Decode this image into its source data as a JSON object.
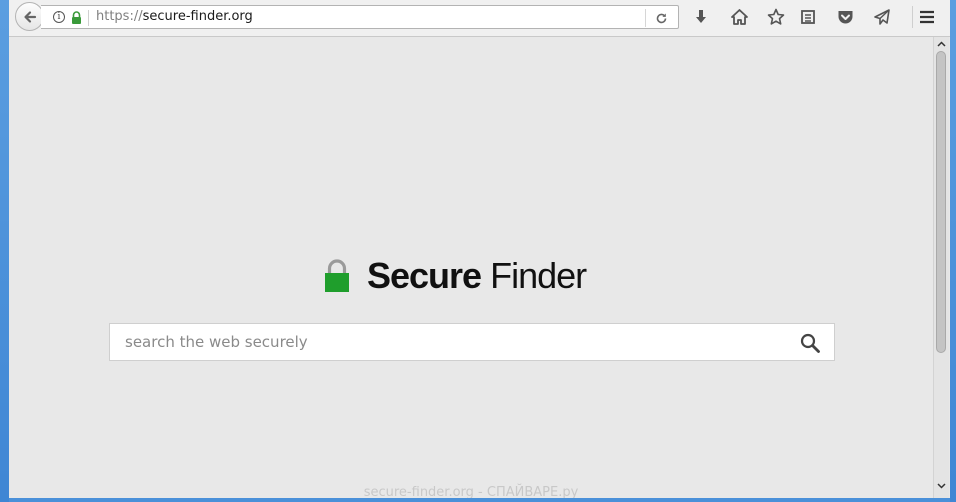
{
  "browser": {
    "url_protocol": "https://",
    "url_host": "secure-finder.org",
    "icons": [
      "back-icon",
      "info-icon",
      "lock-icon",
      "reload-icon",
      "download-icon",
      "home-icon",
      "bookmark-star-icon",
      "reading-list-icon",
      "pocket-icon",
      "send-icon",
      "menu-icon"
    ]
  },
  "page": {
    "logo_bold": "Secure",
    "logo_regular": " Finder",
    "search_placeholder": "search the web securely",
    "watermark": "secure-finder.org - СПАЙВАРЕ.ру"
  },
  "colors": {
    "lock_green": "#1f9e2c",
    "background": "#e8e8e8"
  }
}
